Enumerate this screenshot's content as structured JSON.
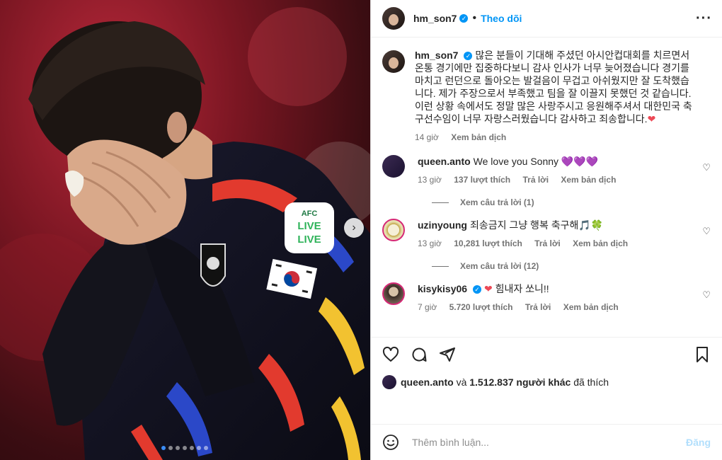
{
  "post": {
    "author": "hm_son7",
    "follow_label": "Theo dõi",
    "separator": "•",
    "caption": "많은 분들이 기대해 주셨던 아시안컵대회를 치르면서 온통 경기에만 집중하다보니 감사 인사가 너무 늦어졌습니다 경기를 마치고 런던으로 돌아오는 발걸음이 무겁고 아쉬웠지만 잘 도착했습니다. 제가 주장으로서 부족했고 팀을 잘 이끌지 못했던 것 같습니다.이런 상황 속에서도 정말 많은 사랑주시고 응원해주셔서 대한민국 축구선수임이 너무 자랑스러웠습니다 감사하고 죄송합니다.",
    "caption_emoji": "❤",
    "time": "14 giờ",
    "translate_label": "Xem bản dịch"
  },
  "comments": [
    {
      "user": "queen.anto",
      "text": "We love you Sonny 💜💜💜",
      "time": "13 giờ",
      "likes": "137 lượt thích",
      "reply": "Trả lời",
      "translate": "Xem bản dịch",
      "view_replies": "Xem câu trả lời (1)"
    },
    {
      "user": "uzinyoung",
      "text": "죄송금지 그냥 행복 축구해🎵🍀",
      "time": "13 giờ",
      "likes": "10,281 lượt thích",
      "reply": "Trả lời",
      "translate": "Xem bản dịch",
      "view_replies": "Xem câu trả lời (12)"
    },
    {
      "user": "kisykisy06",
      "text": "힘내자 쏘니!!",
      "emoji": "❤",
      "time": "7 giờ",
      "likes": "5.720 lượt thích",
      "reply": "Trả lời",
      "translate": "Xem bản dịch"
    }
  ],
  "likes_line": {
    "user": "queen.anto",
    "middle": "và",
    "others": "1.512.837 người khác",
    "suffix": "đã thích"
  },
  "composer": {
    "placeholder": "Thêm bình luận...",
    "post_label": "Đăng"
  },
  "carousel": {
    "slides": 7,
    "active": 0
  },
  "colors": {
    "accent": "#0095f6",
    "heart": "#ed4956"
  },
  "icons": [
    "more-options-icon",
    "verified-badge-icon",
    "heart-icon",
    "comment-icon",
    "share-icon",
    "bookmark-icon",
    "emoji-icon",
    "chevron-right-icon"
  ]
}
